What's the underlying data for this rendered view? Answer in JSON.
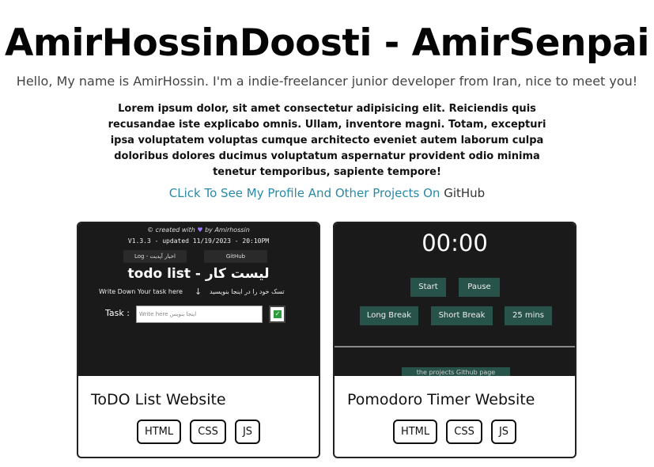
{
  "header": {
    "title": "AmirHossinDoosti - AmirSenpai",
    "subtitle": "Hello, My name is AmirHossin. I'm a indie-freelancer junior developer from Iran, nice to meet you!",
    "lorem": "Lorem ipsum dolor, sit amet consectetur adipisicing elit. Reiciendis quis recusandae iste explicabo omnis. Ullam, inventore magni. Totam, excepturi ipsa voluptatem voluptas cumque architecto eveniet autem laborum culpa doloribus dolores ducimus voluptatum aspernatur provident odio minima tenetur temporibus, sapiente tempore!"
  },
  "github": {
    "prefix": "CLick To See My Profile And Other Projects On ",
    "link_label": "GitHub"
  },
  "projects": [
    {
      "title": "ToDO List Website",
      "tags": [
        "HTML",
        "CSS",
        "JS"
      ],
      "preview": {
        "credit_prefix": "© created with ",
        "heart_icon": "heart-icon",
        "credit_suffix": " by Amirhossin",
        "version": "V1.3.3 - updated 11/19/2023 - 20:10PM",
        "btn_log": "Log - اخبار آپدیت",
        "btn_github": "GitHub",
        "heading": "todo list  -  لیست کار",
        "hint_en": "Write Down Your task here",
        "arrow": "↓",
        "hint_fa": "تسک خود را در اینجا بنویسید",
        "task_label": "Task  :",
        "input_placeholder": "Write here   اینجا بنویس",
        "check_mark": "✓"
      }
    },
    {
      "title": "Pomodoro Timer Website",
      "tags": [
        "HTML",
        "CSS",
        "JS"
      ],
      "preview": {
        "time": "00:00",
        "start": "Start",
        "pause": "Pause",
        "long_break": "Long Break",
        "short_break": "Short Break",
        "mins": "25 mins",
        "footer": "the projects Github page"
      }
    }
  ]
}
